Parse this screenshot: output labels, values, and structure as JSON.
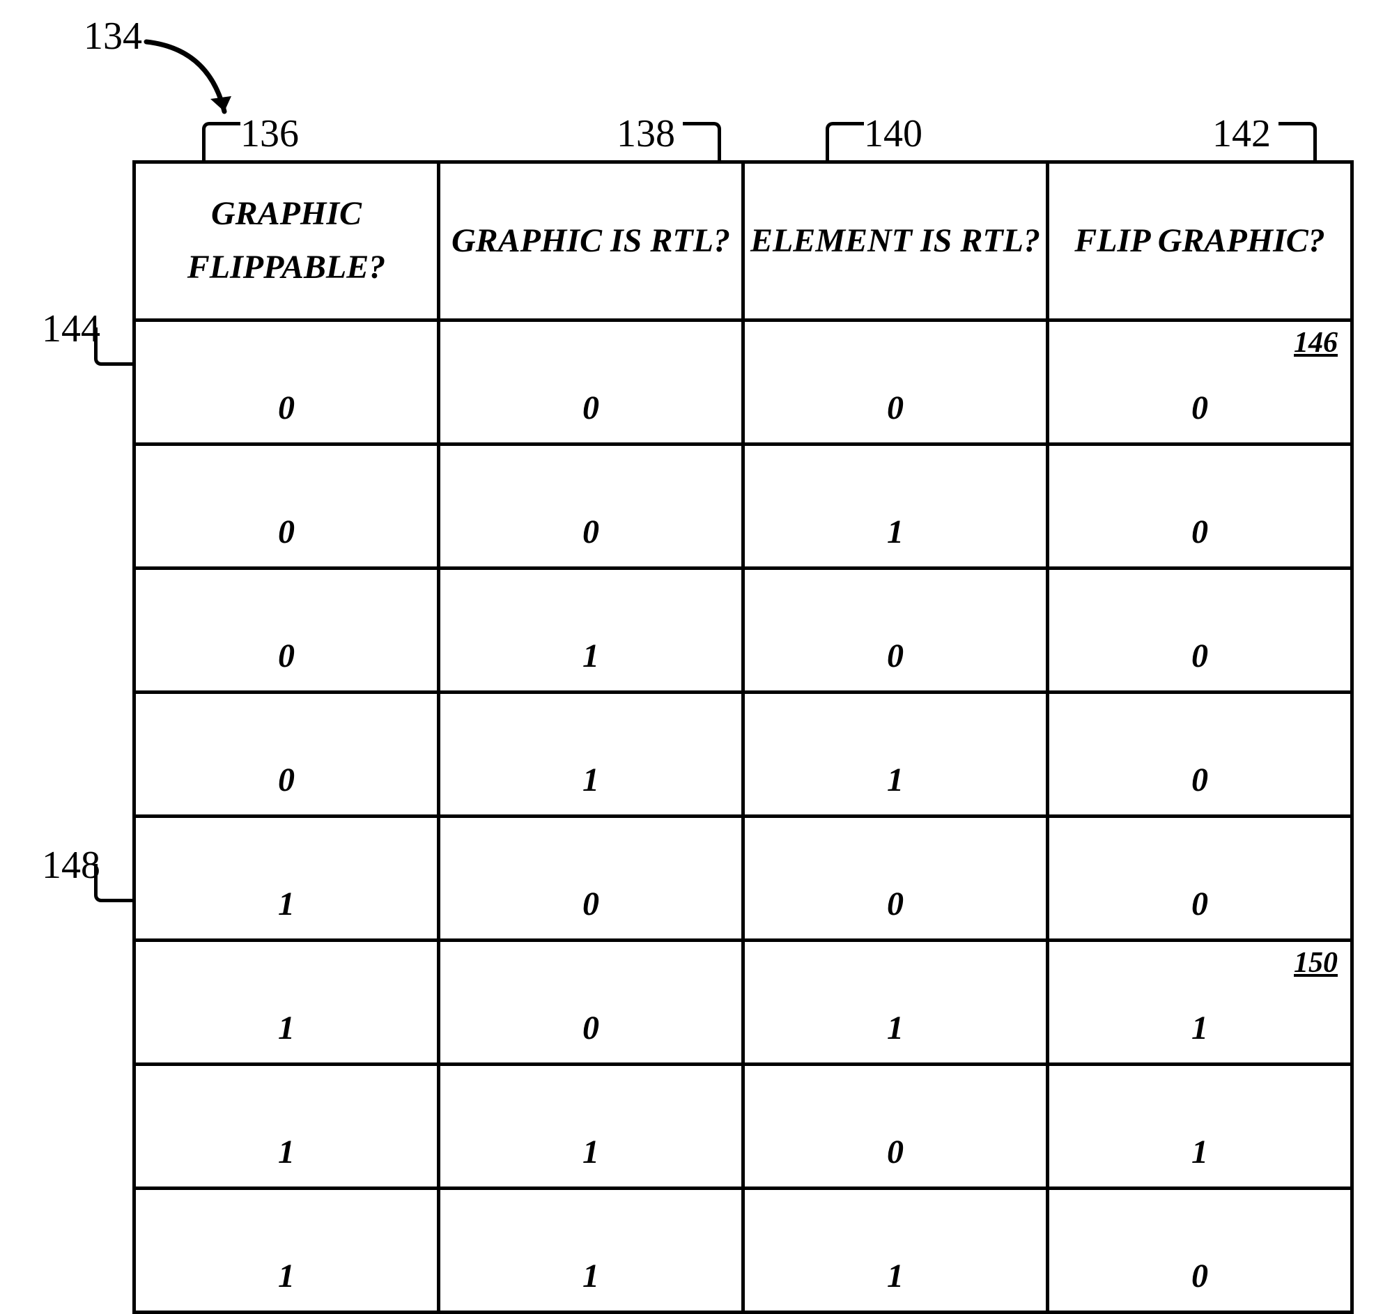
{
  "diagram_ref": "134",
  "columns": [
    {
      "ref": "136",
      "header": "GRAPHIC FLIPPABLE?"
    },
    {
      "ref": "138",
      "header": "GRAPHIC IS RTL?"
    },
    {
      "ref": "140",
      "header": "ELEMENT IS RTL?"
    },
    {
      "ref": "142",
      "header": "FLIP GRAPHIC?"
    }
  ],
  "row_refs": {
    "r1": "144",
    "r6": "148"
  },
  "cell_refs": {
    "r1c4": "146",
    "r6c4": "150"
  },
  "chart_data": {
    "type": "table",
    "columns": [
      "GRAPHIC FLIPPABLE?",
      "GRAPHIC IS RTL?",
      "ELEMENT IS RTL?",
      "FLIP GRAPHIC?"
    ],
    "rows": [
      [
        0,
        0,
        0,
        0
      ],
      [
        0,
        0,
        1,
        0
      ],
      [
        0,
        1,
        0,
        0
      ],
      [
        0,
        1,
        1,
        0
      ],
      [
        1,
        0,
        0,
        0
      ],
      [
        1,
        0,
        1,
        1
      ],
      [
        1,
        1,
        0,
        1
      ],
      [
        1,
        1,
        1,
        0
      ]
    ]
  }
}
